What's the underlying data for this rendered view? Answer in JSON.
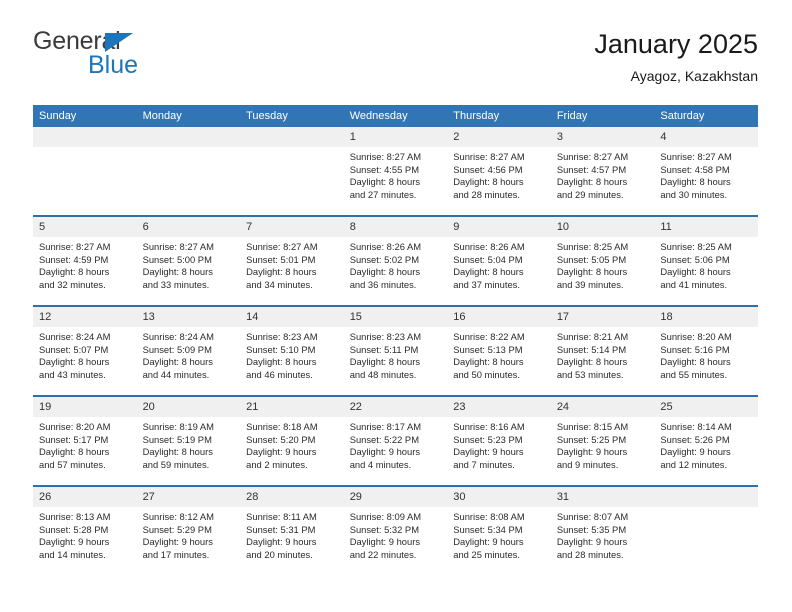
{
  "brand": {
    "name_line1": "General",
    "name_line2": "Blue",
    "triangle_icon": "triangle-icon",
    "accent_color": "#1b76bc"
  },
  "header": {
    "title": "January 2025",
    "subtitle": "Ayagoz, Kazakhstan"
  },
  "calendar": {
    "header_bg": "#3275b5",
    "daynum_bg": "#f0f0f0",
    "row_divider_color": "#2f6fad",
    "weekday_headers": [
      "Sunday",
      "Monday",
      "Tuesday",
      "Wednesday",
      "Thursday",
      "Friday",
      "Saturday"
    ],
    "weeks": [
      [
        {
          "day": "",
          "blank": true,
          "sunrise": "",
          "sunset": "",
          "daylight1": "",
          "daylight2": ""
        },
        {
          "day": "",
          "blank": true,
          "sunrise": "",
          "sunset": "",
          "daylight1": "",
          "daylight2": ""
        },
        {
          "day": "",
          "blank": true,
          "sunrise": "",
          "sunset": "",
          "daylight1": "",
          "daylight2": ""
        },
        {
          "day": "1",
          "blank": false,
          "sunrise": "Sunrise: 8:27 AM",
          "sunset": "Sunset: 4:55 PM",
          "daylight1": "Daylight: 8 hours",
          "daylight2": "and 27 minutes."
        },
        {
          "day": "2",
          "blank": false,
          "sunrise": "Sunrise: 8:27 AM",
          "sunset": "Sunset: 4:56 PM",
          "daylight1": "Daylight: 8 hours",
          "daylight2": "and 28 minutes."
        },
        {
          "day": "3",
          "blank": false,
          "sunrise": "Sunrise: 8:27 AM",
          "sunset": "Sunset: 4:57 PM",
          "daylight1": "Daylight: 8 hours",
          "daylight2": "and 29 minutes."
        },
        {
          "day": "4",
          "blank": false,
          "sunrise": "Sunrise: 8:27 AM",
          "sunset": "Sunset: 4:58 PM",
          "daylight1": "Daylight: 8 hours",
          "daylight2": "and 30 minutes."
        }
      ],
      [
        {
          "day": "5",
          "blank": false,
          "sunrise": "Sunrise: 8:27 AM",
          "sunset": "Sunset: 4:59 PM",
          "daylight1": "Daylight: 8 hours",
          "daylight2": "and 32 minutes."
        },
        {
          "day": "6",
          "blank": false,
          "sunrise": "Sunrise: 8:27 AM",
          "sunset": "Sunset: 5:00 PM",
          "daylight1": "Daylight: 8 hours",
          "daylight2": "and 33 minutes."
        },
        {
          "day": "7",
          "blank": false,
          "sunrise": "Sunrise: 8:27 AM",
          "sunset": "Sunset: 5:01 PM",
          "daylight1": "Daylight: 8 hours",
          "daylight2": "and 34 minutes."
        },
        {
          "day": "8",
          "blank": false,
          "sunrise": "Sunrise: 8:26 AM",
          "sunset": "Sunset: 5:02 PM",
          "daylight1": "Daylight: 8 hours",
          "daylight2": "and 36 minutes."
        },
        {
          "day": "9",
          "blank": false,
          "sunrise": "Sunrise: 8:26 AM",
          "sunset": "Sunset: 5:04 PM",
          "daylight1": "Daylight: 8 hours",
          "daylight2": "and 37 minutes."
        },
        {
          "day": "10",
          "blank": false,
          "sunrise": "Sunrise: 8:25 AM",
          "sunset": "Sunset: 5:05 PM",
          "daylight1": "Daylight: 8 hours",
          "daylight2": "and 39 minutes."
        },
        {
          "day": "11",
          "blank": false,
          "sunrise": "Sunrise: 8:25 AM",
          "sunset": "Sunset: 5:06 PM",
          "daylight1": "Daylight: 8 hours",
          "daylight2": "and 41 minutes."
        }
      ],
      [
        {
          "day": "12",
          "blank": false,
          "sunrise": "Sunrise: 8:24 AM",
          "sunset": "Sunset: 5:07 PM",
          "daylight1": "Daylight: 8 hours",
          "daylight2": "and 43 minutes."
        },
        {
          "day": "13",
          "blank": false,
          "sunrise": "Sunrise: 8:24 AM",
          "sunset": "Sunset: 5:09 PM",
          "daylight1": "Daylight: 8 hours",
          "daylight2": "and 44 minutes."
        },
        {
          "day": "14",
          "blank": false,
          "sunrise": "Sunrise: 8:23 AM",
          "sunset": "Sunset: 5:10 PM",
          "daylight1": "Daylight: 8 hours",
          "daylight2": "and 46 minutes."
        },
        {
          "day": "15",
          "blank": false,
          "sunrise": "Sunrise: 8:23 AM",
          "sunset": "Sunset: 5:11 PM",
          "daylight1": "Daylight: 8 hours",
          "daylight2": "and 48 minutes."
        },
        {
          "day": "16",
          "blank": false,
          "sunrise": "Sunrise: 8:22 AM",
          "sunset": "Sunset: 5:13 PM",
          "daylight1": "Daylight: 8 hours",
          "daylight2": "and 50 minutes."
        },
        {
          "day": "17",
          "blank": false,
          "sunrise": "Sunrise: 8:21 AM",
          "sunset": "Sunset: 5:14 PM",
          "daylight1": "Daylight: 8 hours",
          "daylight2": "and 53 minutes."
        },
        {
          "day": "18",
          "blank": false,
          "sunrise": "Sunrise: 8:20 AM",
          "sunset": "Sunset: 5:16 PM",
          "daylight1": "Daylight: 8 hours",
          "daylight2": "and 55 minutes."
        }
      ],
      [
        {
          "day": "19",
          "blank": false,
          "sunrise": "Sunrise: 8:20 AM",
          "sunset": "Sunset: 5:17 PM",
          "daylight1": "Daylight: 8 hours",
          "daylight2": "and 57 minutes."
        },
        {
          "day": "20",
          "blank": false,
          "sunrise": "Sunrise: 8:19 AM",
          "sunset": "Sunset: 5:19 PM",
          "daylight1": "Daylight: 8 hours",
          "daylight2": "and 59 minutes."
        },
        {
          "day": "21",
          "blank": false,
          "sunrise": "Sunrise: 8:18 AM",
          "sunset": "Sunset: 5:20 PM",
          "daylight1": "Daylight: 9 hours",
          "daylight2": "and 2 minutes."
        },
        {
          "day": "22",
          "blank": false,
          "sunrise": "Sunrise: 8:17 AM",
          "sunset": "Sunset: 5:22 PM",
          "daylight1": "Daylight: 9 hours",
          "daylight2": "and 4 minutes."
        },
        {
          "day": "23",
          "blank": false,
          "sunrise": "Sunrise: 8:16 AM",
          "sunset": "Sunset: 5:23 PM",
          "daylight1": "Daylight: 9 hours",
          "daylight2": "and 7 minutes."
        },
        {
          "day": "24",
          "blank": false,
          "sunrise": "Sunrise: 8:15 AM",
          "sunset": "Sunset: 5:25 PM",
          "daylight1": "Daylight: 9 hours",
          "daylight2": "and 9 minutes."
        },
        {
          "day": "25",
          "blank": false,
          "sunrise": "Sunrise: 8:14 AM",
          "sunset": "Sunset: 5:26 PM",
          "daylight1": "Daylight: 9 hours",
          "daylight2": "and 12 minutes."
        }
      ],
      [
        {
          "day": "26",
          "blank": false,
          "sunrise": "Sunrise: 8:13 AM",
          "sunset": "Sunset: 5:28 PM",
          "daylight1": "Daylight: 9 hours",
          "daylight2": "and 14 minutes."
        },
        {
          "day": "27",
          "blank": false,
          "sunrise": "Sunrise: 8:12 AM",
          "sunset": "Sunset: 5:29 PM",
          "daylight1": "Daylight: 9 hours",
          "daylight2": "and 17 minutes."
        },
        {
          "day": "28",
          "blank": false,
          "sunrise": "Sunrise: 8:11 AM",
          "sunset": "Sunset: 5:31 PM",
          "daylight1": "Daylight: 9 hours",
          "daylight2": "and 20 minutes."
        },
        {
          "day": "29",
          "blank": false,
          "sunrise": "Sunrise: 8:09 AM",
          "sunset": "Sunset: 5:32 PM",
          "daylight1": "Daylight: 9 hours",
          "daylight2": "and 22 minutes."
        },
        {
          "day": "30",
          "blank": false,
          "sunrise": "Sunrise: 8:08 AM",
          "sunset": "Sunset: 5:34 PM",
          "daylight1": "Daylight: 9 hours",
          "daylight2": "and 25 minutes."
        },
        {
          "day": "31",
          "blank": false,
          "sunrise": "Sunrise: 8:07 AM",
          "sunset": "Sunset: 5:35 PM",
          "daylight1": "Daylight: 9 hours",
          "daylight2": "and 28 minutes."
        },
        {
          "day": "",
          "blank": true,
          "sunrise": "",
          "sunset": "",
          "daylight1": "",
          "daylight2": ""
        }
      ]
    ]
  }
}
